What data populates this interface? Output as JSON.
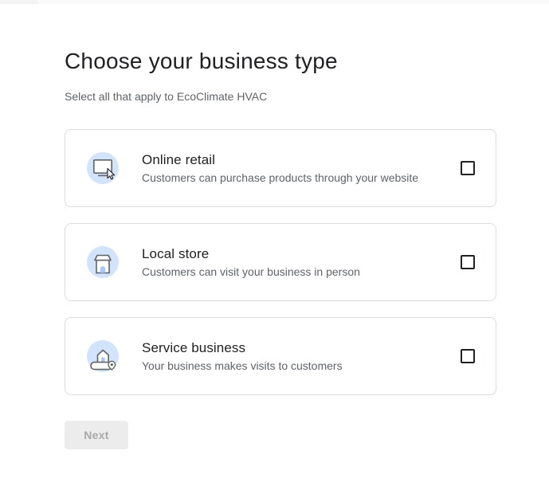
{
  "header": {
    "title": "Choose your business type",
    "subtitle": "Select all that apply to EcoClimate HVAC"
  },
  "options": [
    {
      "title": "Online retail",
      "description": "Customers can purchase products through your website",
      "icon": "monitor-cursor-icon",
      "checked": false
    },
    {
      "title": "Local store",
      "description": "Customers can visit your business in person",
      "icon": "storefront-icon",
      "checked": false
    },
    {
      "title": "Service business",
      "description": "Your business makes visits to customers",
      "icon": "house-location-pin-icon",
      "checked": false
    }
  ],
  "footer": {
    "next_label": "Next",
    "next_enabled": false
  },
  "colors": {
    "text_primary": "#202124",
    "text_secondary": "#5f6368",
    "card_border": "#dadce0",
    "icon_circle_blue": "#d2e3fc",
    "icon_accent_blue": "#a8c7fa",
    "icon_dot_blue": "#8ab4f8",
    "disabled_button_bg": "#ececec",
    "disabled_button_text": "#a9a9a9"
  }
}
